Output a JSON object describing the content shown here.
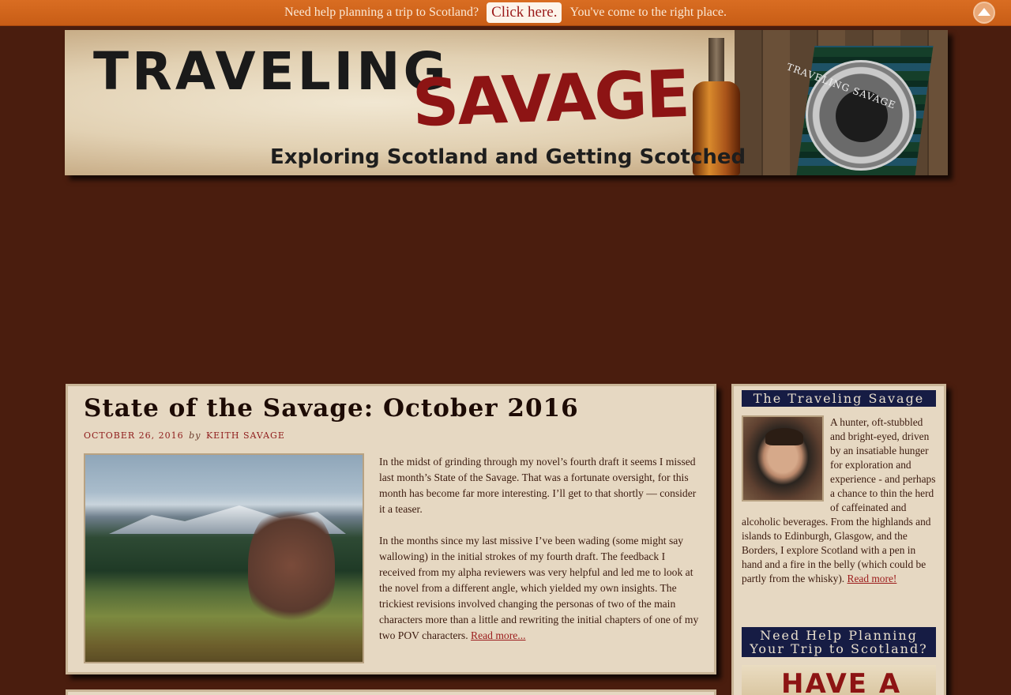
{
  "topbar": {
    "lead_text": "Need help planning a trip to Scotland?",
    "cta_label": "Click here.",
    "trail_text": "You've come to the right place.",
    "hide_icon": "chevron-up-icon"
  },
  "banner": {
    "word1": "TRAVELING",
    "word2": "SAVAGE",
    "tagline": "Exploring Scotland and Getting Scotched",
    "badge_text": "TRAVELING SAVAGE"
  },
  "post": {
    "title": "State of the Savage: October 2016",
    "date": "October 26, 2016",
    "by": "by",
    "author": "Keith Savage",
    "paragraph1": "In the midst of grinding through my novel’s fourth draft it seems I missed last month’s State of the Savage. That was a fortunate oversight, for this month has become far more interesting. I’ll get to that shortly — consider it a teaser.",
    "paragraph2": "In the months since my last missive I’ve been wading (some might say wallowing) in the initial strokes of my fourth draft. The feedback I received from my alpha reviewers was very helpful and led me to look at the novel from a different angle, which yielded my own insights. The trickiest revisions involved changing the personas of two of the main characters more than a little and rewriting the initial chapters of one of my two POV characters.",
    "read_more": "Read more..."
  },
  "sidebar": {
    "about_title": "The Traveling Savage",
    "about_text": "A hunter, oft-stubbled and bright-eyed, driven by an insatiable hunger for exploration and experience - and perhaps a chance to thin the herd of caffeinated and alcoholic beverages. From the highlands and islands to Edinburgh, Glasgow, and the Borders, I explore Scotland with a pen in hand and a fire in the belly (which could be partly from the whisky).",
    "about_link": "Read more!",
    "help_title": "Need Help Planning Your Trip to Scotland?",
    "help_graphic_text": "HAVE A"
  },
  "colors": {
    "background": "#4a1d0e",
    "topbar": "#d96d22",
    "panel": "#e6d8c2",
    "widget_title_bg": "#161c44",
    "link": "#9b1b1b"
  }
}
